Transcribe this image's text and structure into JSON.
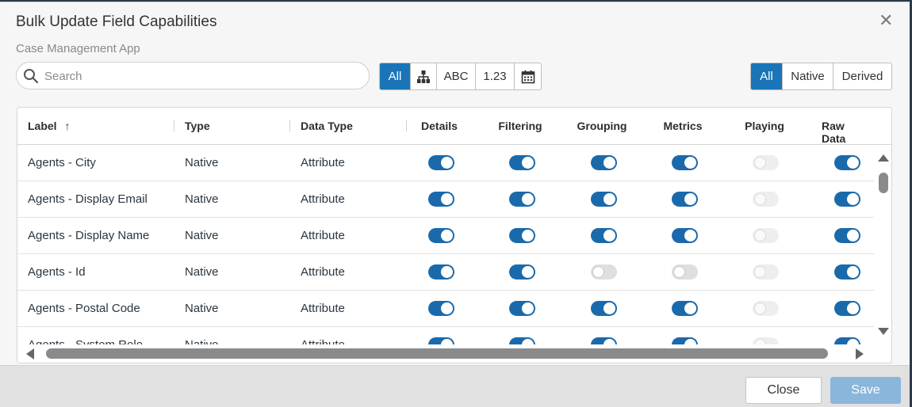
{
  "dialog": {
    "title": "Bulk Update Field Capabilities",
    "subtitle": "Case Management App",
    "close_icon": "close-icon"
  },
  "search": {
    "placeholder": "Search",
    "value": ""
  },
  "type_filter": {
    "selected": "All",
    "options": [
      {
        "label": "All",
        "icon": ""
      },
      {
        "label": "",
        "icon": "hierarchy-icon"
      },
      {
        "label": "ABC",
        "icon": ""
      },
      {
        "label": "1.23",
        "icon": ""
      },
      {
        "label": "",
        "icon": "calendar-icon"
      }
    ]
  },
  "source_filter": {
    "selected": "All",
    "options": [
      "All",
      "Native",
      "Derived"
    ]
  },
  "table": {
    "headers": {
      "label": "Label",
      "sort_indicator": "↑",
      "type": "Type",
      "data_type": "Data Type",
      "details": "Details",
      "filtering": "Filtering",
      "grouping": "Grouping",
      "metrics": "Metrics",
      "playing": "Playing",
      "raw_data": "Raw Data"
    },
    "rows": [
      {
        "label": "Agents - City",
        "type": "Native",
        "data_type": "Attribute",
        "details": "on",
        "filtering": "on",
        "grouping": "on",
        "metrics": "on",
        "playing": "disabled",
        "raw_data": "on"
      },
      {
        "label": "Agents - Display Email",
        "type": "Native",
        "data_type": "Attribute",
        "details": "on",
        "filtering": "on",
        "grouping": "on",
        "metrics": "on",
        "playing": "disabled",
        "raw_data": "on"
      },
      {
        "label": "Agents - Display Name",
        "type": "Native",
        "data_type": "Attribute",
        "details": "on",
        "filtering": "on",
        "grouping": "on",
        "metrics": "on",
        "playing": "disabled",
        "raw_data": "on"
      },
      {
        "label": "Agents - Id",
        "type": "Native",
        "data_type": "Attribute",
        "details": "on",
        "filtering": "on",
        "grouping": "off",
        "metrics": "off",
        "playing": "disabled",
        "raw_data": "on"
      },
      {
        "label": "Agents - Postal Code",
        "type": "Native",
        "data_type": "Attribute",
        "details": "on",
        "filtering": "on",
        "grouping": "on",
        "metrics": "on",
        "playing": "disabled",
        "raw_data": "on"
      },
      {
        "label": "Agents - System Role",
        "type": "Native",
        "data_type": "Attribute",
        "details": "on",
        "filtering": "on",
        "grouping": "on",
        "metrics": "on",
        "playing": "disabled",
        "raw_data": "on"
      }
    ]
  },
  "footer": {
    "close_label": "Close",
    "save_label": "Save"
  },
  "colors": {
    "accent": "#1a75b8",
    "toggle_on": "#1a6aab",
    "save_disabled": "#8bb6db"
  }
}
